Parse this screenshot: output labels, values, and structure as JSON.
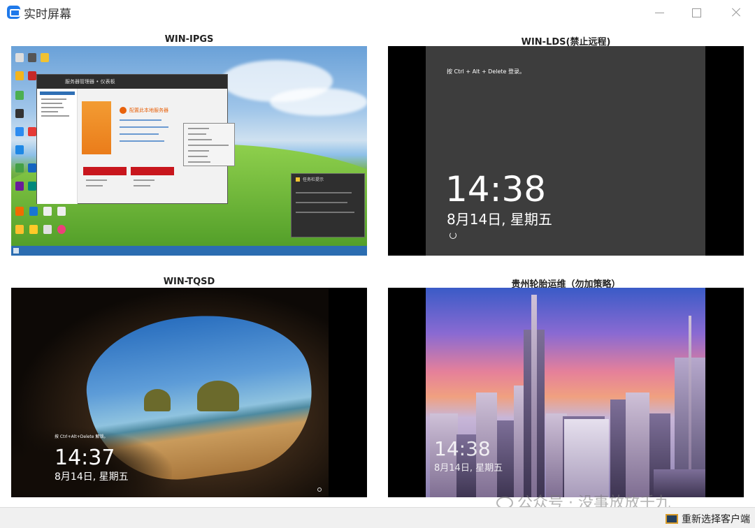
{
  "window": {
    "title": "实时屏幕"
  },
  "panels": [
    {
      "name": "WIN-IPGS",
      "screen": "desktop"
    },
    {
      "name": "WIN-LDS(禁止远程)",
      "screen": "lock",
      "prompt": "按 Ctrl + Alt + Delete 登录。",
      "time": "14:38",
      "date": "8月14日, 星期五"
    },
    {
      "name": "WIN-TQSD",
      "screen": "lock",
      "prompt": "按 Ctrl+Alt+Delete 解锁。",
      "time": "14:37",
      "date": "8月14日, 星期五"
    },
    {
      "name": "贵州轮胎运维（勿加策略）",
      "screen": "lock",
      "time": "14:38",
      "date": "8月14日, 星期五"
    }
  ],
  "desktop": {
    "window_title": "服务器管理器",
    "breadcrumb": "服务器管理器 • 仪表板",
    "banner": "配置此本地服务器",
    "notification_title": "任务栏提示"
  },
  "footer": {
    "reselect_label": "重新选择客户端",
    "watermark": "公众号 · 没事放放千九"
  }
}
